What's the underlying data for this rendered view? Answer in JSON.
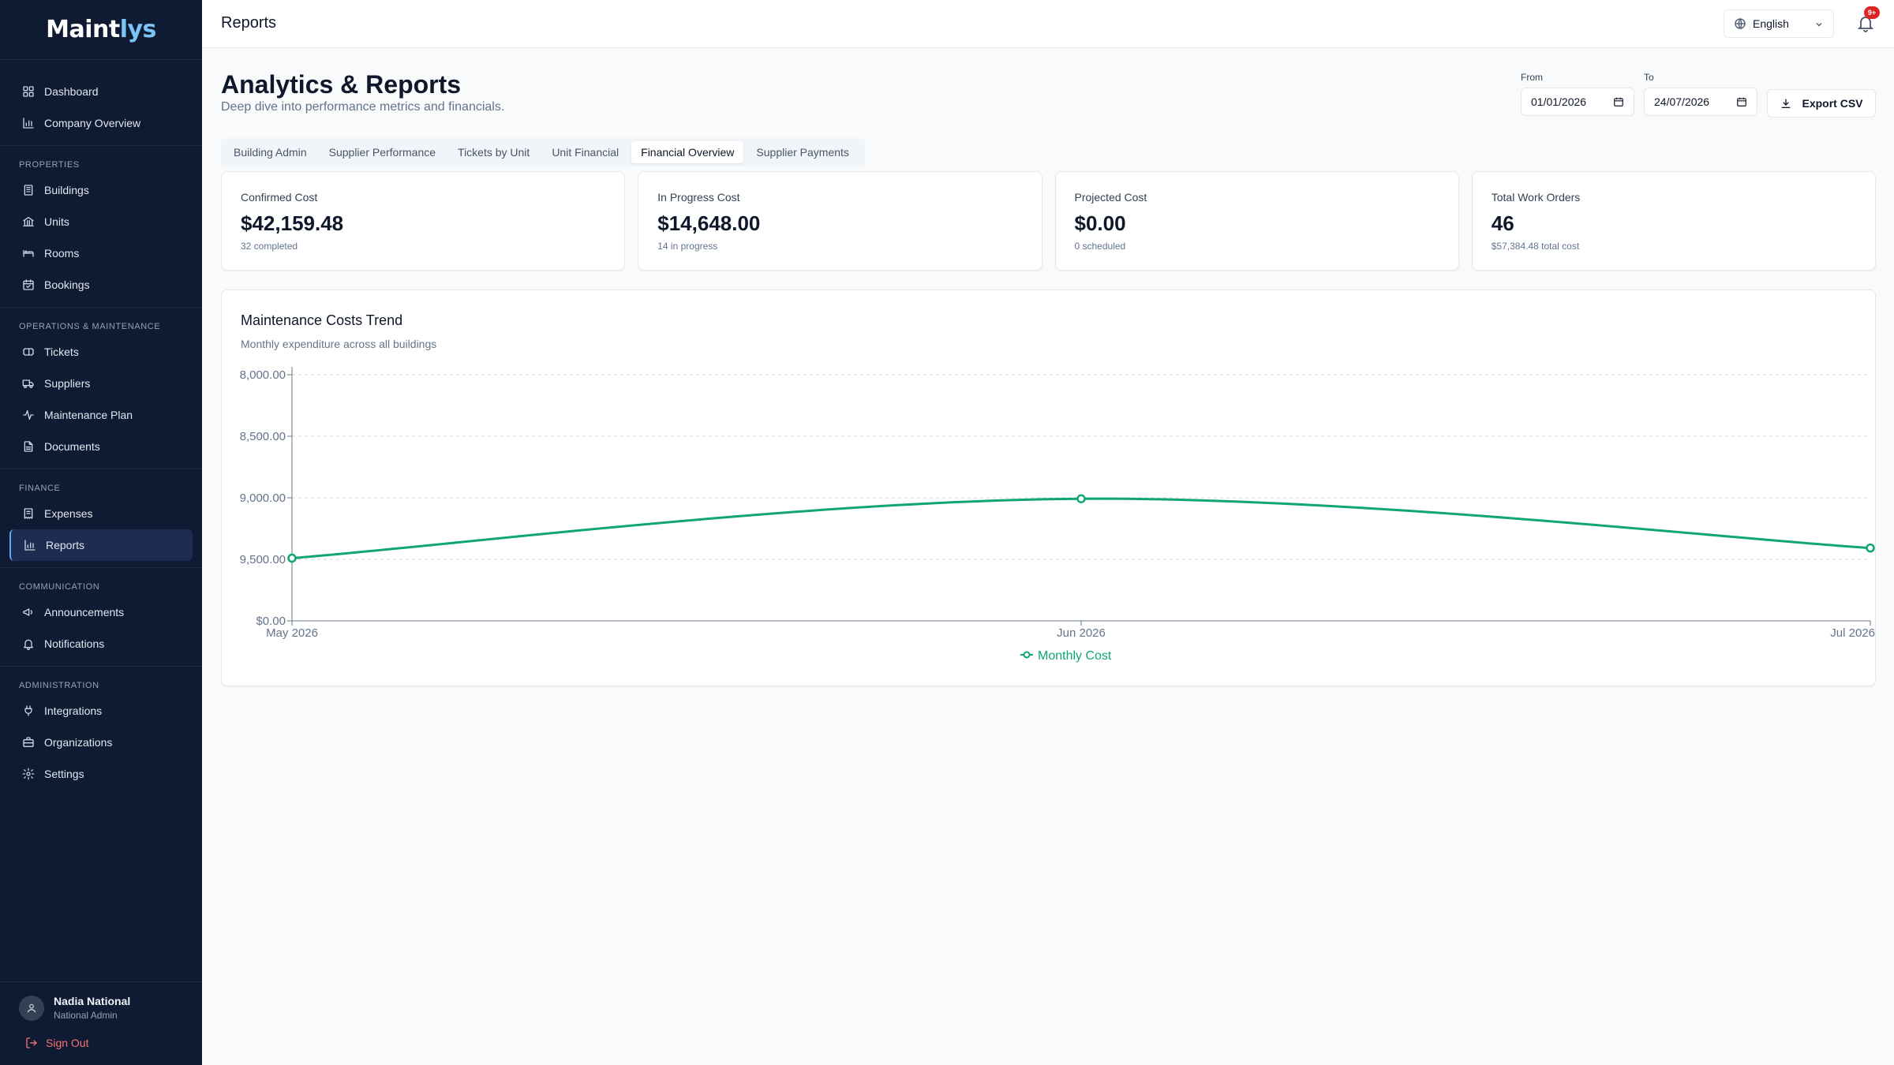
{
  "app": {
    "logo_main": "Maint",
    "logo_accent": "lys"
  },
  "sidebar": {
    "top_items": [
      {
        "label": "Dashboard",
        "icon": "grid-icon"
      },
      {
        "label": "Company Overview",
        "icon": "bar-chart-icon"
      }
    ],
    "groups": [
      {
        "heading": "PROPERTIES",
        "items": [
          {
            "label": "Buildings",
            "icon": "building-icon"
          },
          {
            "label": "Units",
            "icon": "bank-icon"
          },
          {
            "label": "Rooms",
            "icon": "bed-icon"
          },
          {
            "label": "Bookings",
            "icon": "calendar-check-icon"
          }
        ]
      },
      {
        "heading": "OPERATIONS & MAINTENANCE",
        "items": [
          {
            "label": "Tickets",
            "icon": "ticket-icon"
          },
          {
            "label": "Suppliers",
            "icon": "truck-icon"
          },
          {
            "label": "Maintenance Plan",
            "icon": "activity-icon"
          },
          {
            "label": "Documents",
            "icon": "file-text-icon"
          }
        ]
      },
      {
        "heading": "FINANCE",
        "items": [
          {
            "label": "Expenses",
            "icon": "receipt-icon"
          },
          {
            "label": "Reports",
            "icon": "bar-chart-icon",
            "active": true
          }
        ]
      },
      {
        "heading": "COMMUNICATION",
        "items": [
          {
            "label": "Announcements",
            "icon": "megaphone-icon"
          },
          {
            "label": "Notifications",
            "icon": "bell-icon"
          }
        ]
      },
      {
        "heading": "ADMINISTRATION",
        "items": [
          {
            "label": "Integrations",
            "icon": "plug-icon"
          },
          {
            "label": "Organizations",
            "icon": "briefcase-icon"
          },
          {
            "label": "Settings",
            "icon": "gear-icon"
          }
        ]
      }
    ],
    "profile": {
      "name": "Nadia National",
      "role": "National Admin"
    },
    "signout_label": "Sign Out"
  },
  "topbar": {
    "title": "Reports",
    "language": "English",
    "notification_badge": "9+"
  },
  "page": {
    "title": "Analytics & Reports",
    "subtitle": "Deep dive into performance metrics and financials.",
    "from_label": "From",
    "from_value": "01/01/2026",
    "to_label": "To",
    "to_value": "24/07/2026",
    "export_label": "Export CSV"
  },
  "tabs": [
    {
      "label": "Building Admin",
      "active": false
    },
    {
      "label": "Supplier Performance",
      "active": false
    },
    {
      "label": "Tickets by Unit",
      "active": false
    },
    {
      "label": "Unit Financial",
      "active": false
    },
    {
      "label": "Financial Overview",
      "active": true
    },
    {
      "label": "Supplier Payments",
      "active": false
    }
  ],
  "cards": [
    {
      "label": "Confirmed Cost",
      "value": "$42,159.48",
      "sub": "32 completed"
    },
    {
      "label": "In Progress Cost",
      "value": "$14,648.00",
      "sub": "14 in progress"
    },
    {
      "label": "Projected Cost",
      "value": "$0.00",
      "sub": "0 scheduled"
    },
    {
      "label": "Total Work Orders",
      "value": "46",
      "sub": "$57,384.48 total cost"
    }
  ],
  "chart": {
    "title": "Maintenance Costs Trend",
    "subtitle": "Monthly expenditure across all buildings"
  },
  "chart_data": {
    "type": "line",
    "categories": [
      "May 2026",
      "Jun 2026",
      "Jul 2026"
    ],
    "series": [
      {
        "name": "Monthly Cost",
        "values": [
          9680,
          18850,
          11250
        ],
        "color": "#10a673"
      }
    ],
    "y_ticks": [
      0,
      9500,
      19000,
      28500,
      38000
    ],
    "y_tick_labels": [
      "$0.00",
      "9,500.00",
      "9,000.00",
      "8,500.00",
      "8,000.00"
    ],
    "ylim": [
      0,
      38000
    ],
    "grid": true,
    "legend": "bottom-center"
  }
}
